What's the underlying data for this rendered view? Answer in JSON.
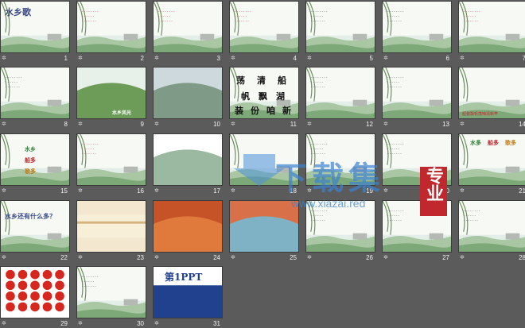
{
  "slide_count": 31,
  "slides": [
    {
      "number": "1",
      "title": "水乡歌"
    },
    {
      "number": "2"
    },
    {
      "number": "3"
    },
    {
      "number": "4"
    },
    {
      "number": "5"
    },
    {
      "number": "6"
    },
    {
      "number": "7"
    },
    {
      "number": "8"
    },
    {
      "number": "9",
      "caption": "水乡风光"
    },
    {
      "number": "10"
    },
    {
      "number": "11",
      "chars": [
        "荡",
        "清",
        "船",
        "帆",
        "飘",
        "湖",
        "装",
        "份",
        "咱",
        "新"
      ]
    },
    {
      "number": "12"
    },
    {
      "number": "13"
    },
    {
      "number": "14",
      "footer": "船装飘帆荡咱清新竿"
    },
    {
      "number": "15",
      "items": [
        "水乡",
        "船多",
        "歌多"
      ]
    },
    {
      "number": "16"
    },
    {
      "number": "17"
    },
    {
      "number": "18"
    },
    {
      "number": "19"
    },
    {
      "number": "20"
    },
    {
      "number": "21",
      "items": [
        "水多",
        "船多",
        "歌多"
      ]
    },
    {
      "number": "22",
      "title": "水乡还有什么多？"
    },
    {
      "number": "23"
    },
    {
      "number": "24"
    },
    {
      "number": "25"
    },
    {
      "number": "26"
    },
    {
      "number": "27"
    },
    {
      "number": "28"
    },
    {
      "number": "29"
    },
    {
      "number": "30"
    },
    {
      "number": "31",
      "brand": "第1PPT"
    }
  ],
  "watermark": {
    "line1": "下载集",
    "badge": "专业",
    "url": "www.xiazai.red"
  },
  "colors": {
    "background": "#5b5b5b",
    "accent": "#c0282d",
    "title": "#3a4a8a",
    "sky": "#dbe8f0",
    "water": "#5fa2c9"
  }
}
